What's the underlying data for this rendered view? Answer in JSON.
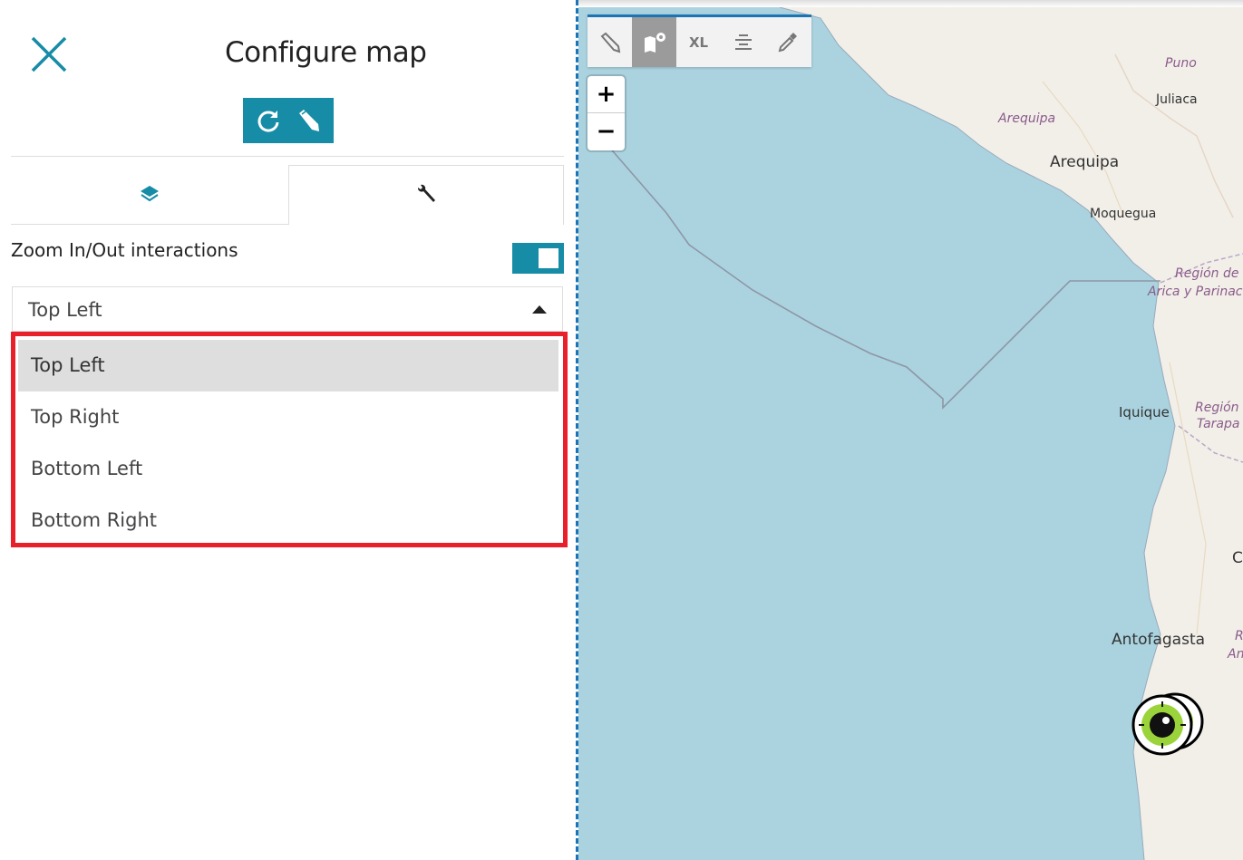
{
  "panel": {
    "title": "Configure map",
    "close_icon": "close-icon",
    "actions": [
      {
        "icon": "refresh-icon"
      },
      {
        "icon": "pencil-icon"
      }
    ],
    "tabs": [
      {
        "icon": "layers-icon",
        "active": false
      },
      {
        "icon": "wrench-icon",
        "active": true
      }
    ],
    "zoom_setting": {
      "label": "Zoom In/Out interactions",
      "enabled": true
    },
    "position_select": {
      "value": "Top Left",
      "options": [
        "Top Left",
        "Top Right",
        "Bottom Left",
        "Bottom Right"
      ],
      "highlighted": "Top Left"
    }
  },
  "map": {
    "toolbar": [
      {
        "icon": "pencil-icon",
        "label": "",
        "active": false
      },
      {
        "icon": "map-settings-icon",
        "label": "",
        "active": true
      },
      {
        "icon": "text-size-icon",
        "label": "XL",
        "active": false
      },
      {
        "icon": "align-center-icon",
        "label": "",
        "active": false
      },
      {
        "icon": "eyedropper-icon",
        "label": "",
        "active": false
      }
    ],
    "zoom_in": "+",
    "zoom_out": "−",
    "places": {
      "puno": "Puno",
      "juliaca": "Juliaca",
      "arequipa_region": "Arequipa",
      "arequipa": "Arequipa",
      "moquegua": "Moquegua",
      "arica_region_1": "Región de",
      "arica_region_2": "Arica y Parinac",
      "iquique": "Iquique",
      "tarapaca_region_1": "Región",
      "tarapaca_region_2": "Tarapa",
      "antofagasta": "Antofagasta",
      "cut_c": "C",
      "cut_r": "R",
      "cut_an": "An"
    },
    "colors": {
      "accent": "#168ca6",
      "water": "#aad3df",
      "land": "#f2efe9",
      "highlight_border": "#e8202a"
    }
  }
}
